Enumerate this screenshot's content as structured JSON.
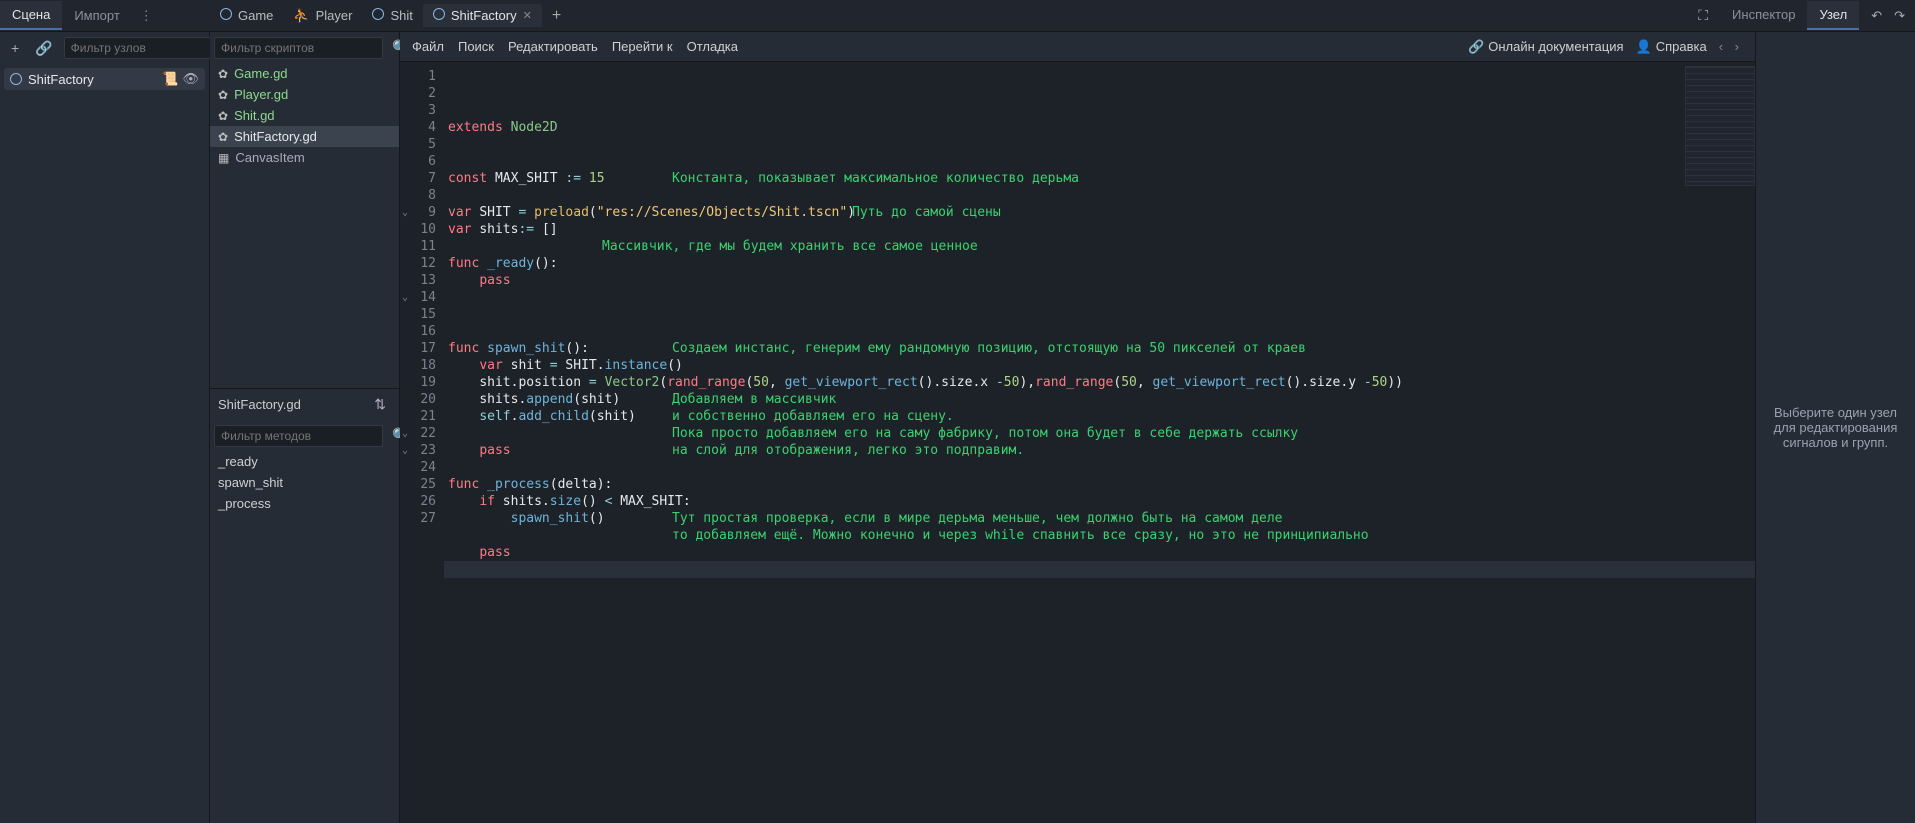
{
  "topLeftTabs": {
    "scene": "Сцена",
    "import": "Импорт"
  },
  "sceneTabs": [
    {
      "label": "Game"
    },
    {
      "label": "Player"
    },
    {
      "label": "Shit"
    },
    {
      "label": "ShitFactory",
      "active": true
    }
  ],
  "rightTabs": {
    "inspector": "Инспектор",
    "node": "Узел"
  },
  "leftToolbar": {
    "filterPlaceholder": "Фильтр узлов"
  },
  "sceneTree": {
    "root": "ShitFactory"
  },
  "scriptsFilterPlaceholder": "Фильтр скриптов",
  "scripts": [
    {
      "label": "Game.gd"
    },
    {
      "label": "Player.gd"
    },
    {
      "label": "Shit.gd"
    },
    {
      "label": "ShitFactory.gd",
      "selected": true
    },
    {
      "label": "CanvasItem",
      "canvas": true
    }
  ],
  "methodsHeader": "ShitFactory.gd",
  "methodsFilterPlaceholder": "Фильтр методов",
  "methods": [
    "_ready",
    "spawn_shit",
    "_process"
  ],
  "menus": [
    "Файл",
    "Поиск",
    "Редактировать",
    "Перейти к",
    "Отладка"
  ],
  "menuRight": {
    "docs": "Онлайн документация",
    "help": "Справка"
  },
  "code": {
    "lines": [
      {
        "n": 1,
        "tokens": [
          [
            "kw",
            "extends"
          ],
          [
            "sp",
            " "
          ],
          [
            "type",
            "Node2D"
          ]
        ]
      },
      {
        "n": 2,
        "tokens": []
      },
      {
        "n": 3,
        "tokens": []
      },
      {
        "n": 4,
        "tokens": [
          [
            "kw",
            "const"
          ],
          [
            "sp",
            " "
          ],
          [
            "var",
            "MAX_SHIT"
          ],
          [
            "sp",
            " "
          ],
          [
            "op",
            ":="
          ],
          [
            "sp",
            " "
          ],
          [
            "num",
            "15"
          ]
        ],
        "annot": "Константа, показывает максимальное количество дерьма",
        "annotX": 180
      },
      {
        "n": 5,
        "tokens": []
      },
      {
        "n": 6,
        "tokens": [
          [
            "kw",
            "var"
          ],
          [
            "sp",
            " "
          ],
          [
            "var",
            "SHIT"
          ],
          [
            "sp",
            " "
          ],
          [
            "op",
            "="
          ],
          [
            "sp",
            " "
          ],
          [
            "builtin",
            "preload"
          ],
          [
            "var",
            "("
          ],
          [
            "str",
            "\"res://Scenes/Objects/Shit.tscn\""
          ],
          [
            "var",
            ")"
          ]
        ],
        "annot": "Путь до самой сцены",
        "annotX": 360
      },
      {
        "n": 7,
        "tokens": [
          [
            "kw",
            "var"
          ],
          [
            "sp",
            " "
          ],
          [
            "var",
            "shits"
          ],
          [
            "op",
            ":="
          ],
          [
            "sp",
            " "
          ],
          [
            "var",
            "[]"
          ]
        ]
      },
      {
        "n": 8,
        "tokens": [],
        "annot": "Массивчик, где мы будем хранить все самое ценное",
        "annotX": 110
      },
      {
        "n": 9,
        "fold": true,
        "tokens": [
          [
            "kw",
            "func"
          ],
          [
            "sp",
            " "
          ],
          [
            "fn",
            "_ready"
          ],
          [
            "var",
            "():"
          ]
        ]
      },
      {
        "n": 10,
        "tokens": [
          [
            "indent",
            "    "
          ],
          [
            "kw",
            "pass"
          ]
        ]
      },
      {
        "n": 11,
        "tokens": []
      },
      {
        "n": 12,
        "tokens": []
      },
      {
        "n": 13,
        "tokens": []
      },
      {
        "n": 14,
        "fold": true,
        "tokens": [
          [
            "kw",
            "func"
          ],
          [
            "sp",
            " "
          ],
          [
            "fn",
            "spawn_shit"
          ],
          [
            "var",
            "():"
          ]
        ],
        "annot": "Создаем инстанс, генерим ему рандомную позицию, отстоящую на 50 пикселей от краев",
        "annotX": 180
      },
      {
        "n": 15,
        "tokens": [
          [
            "indent",
            "    "
          ],
          [
            "kw",
            "var"
          ],
          [
            "sp",
            " "
          ],
          [
            "var",
            "shit"
          ],
          [
            "sp",
            " "
          ],
          [
            "op",
            "="
          ],
          [
            "sp",
            " "
          ],
          [
            "var",
            "SHIT."
          ],
          [
            "fn",
            "instance"
          ],
          [
            "var",
            "()"
          ]
        ]
      },
      {
        "n": 16,
        "tokens": [
          [
            "indent",
            "    "
          ],
          [
            "var",
            "shit."
          ],
          [
            "var",
            "position"
          ],
          [
            "sp",
            " "
          ],
          [
            "op",
            "="
          ],
          [
            "sp",
            " "
          ],
          [
            "type",
            "Vector2"
          ],
          [
            "var",
            "("
          ],
          [
            "builtin2",
            "rand_range"
          ],
          [
            "var",
            "("
          ],
          [
            "num",
            "50"
          ],
          [
            "var",
            ", "
          ],
          [
            "fn",
            "get_viewport_rect"
          ],
          [
            "var",
            "()."
          ],
          [
            "var",
            "size.x "
          ],
          [
            "op",
            "-"
          ],
          [
            "num",
            "50"
          ],
          [
            "var",
            "),"
          ],
          [
            "builtin2",
            "rand_range"
          ],
          [
            "var",
            "("
          ],
          [
            "num",
            "50"
          ],
          [
            "var",
            ", "
          ],
          [
            "fn",
            "get_viewport_rect"
          ],
          [
            "var",
            "()."
          ],
          [
            "var",
            "size.y "
          ],
          [
            "op",
            "-"
          ],
          [
            "num",
            "50"
          ],
          [
            "var",
            "))"
          ]
        ]
      },
      {
        "n": 17,
        "tokens": [
          [
            "indent",
            "    "
          ],
          [
            "var",
            "shits."
          ],
          [
            "fn",
            "append"
          ],
          [
            "var",
            "(shit)"
          ]
        ],
        "annot": "Добавляем в массивчик",
        "annotX": 180
      },
      {
        "n": 18,
        "tokens": [
          [
            "indent",
            "    "
          ],
          [
            "self",
            "self"
          ],
          [
            "var",
            "."
          ],
          [
            "fn",
            "add_child"
          ],
          [
            "var",
            "(shit)"
          ]
        ],
        "annot": "и собственно добавляем его на сцену.",
        "annotX": 180
      },
      {
        "n": 19,
        "tokens": [],
        "annot": "Пока просто добавляем его на саму фабрику, потом она будет в себе держать ссылку",
        "annotX": 180
      },
      {
        "n": 20,
        "tokens": [
          [
            "indent",
            "    "
          ],
          [
            "kw",
            "pass"
          ]
        ],
        "annot": "на слой для отображения, легко это подправим.",
        "annotX": 180
      },
      {
        "n": 21,
        "tokens": []
      },
      {
        "n": 22,
        "fold": true,
        "tokens": [
          [
            "kw",
            "func"
          ],
          [
            "sp",
            " "
          ],
          [
            "fn",
            "_process"
          ],
          [
            "var",
            "(delta):"
          ]
        ]
      },
      {
        "n": 23,
        "fold": true,
        "tokens": [
          [
            "indent",
            "    "
          ],
          [
            "kw",
            "if"
          ],
          [
            "sp",
            " "
          ],
          [
            "var",
            "shits."
          ],
          [
            "fn",
            "size"
          ],
          [
            "var",
            "() "
          ],
          [
            "op",
            "<"
          ],
          [
            "sp",
            " "
          ],
          [
            "var",
            "MAX_SHIT:"
          ]
        ]
      },
      {
        "n": 24,
        "tokens": [
          [
            "indent",
            "        "
          ],
          [
            "fn",
            "spawn_shit"
          ],
          [
            "var",
            "()"
          ]
        ],
        "annot": "Тут простая проверка, если в мире дерьма меньше, чем должно быть на самом деле",
        "annotX": 180
      },
      {
        "n": 25,
        "tokens": [],
        "annot": "то добавляем ещё. Можно конечно и через while спавнить все сразу, но это не принципиально",
        "annotX": 180
      },
      {
        "n": 26,
        "tokens": [
          [
            "indent",
            "    "
          ],
          [
            "kw",
            "pass"
          ]
        ]
      },
      {
        "n": 27,
        "tokens": [],
        "current": true
      }
    ]
  },
  "rightPanelMessage": "Выберите один узел для редактирования сигналов и групп."
}
